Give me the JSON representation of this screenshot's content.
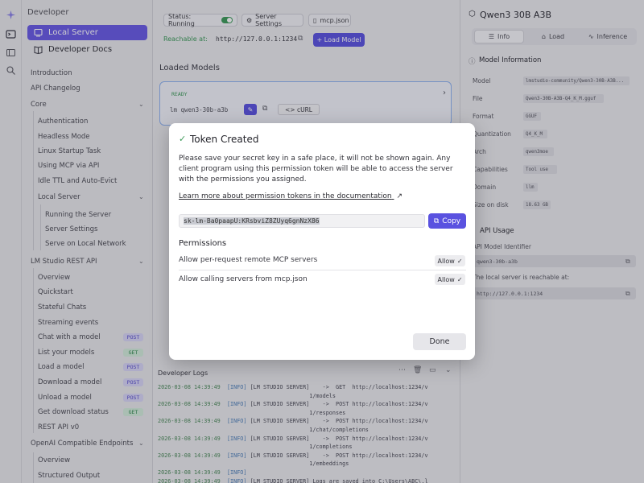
{
  "sidebar": {
    "section_title": "Developer",
    "local_server": "Local Server",
    "developer_docs": "Developer Docs",
    "items": {
      "introduction": "Introduction",
      "api_changelog": "API Changelog",
      "core": "Core",
      "authentication": "Authentication",
      "headless_mode": "Headless Mode",
      "linux_startup_task": "Linux Startup Task",
      "using_mcp": "Using MCP via API",
      "idle_ttl": "Idle TTL and Auto-Evict",
      "local_server": "Local Server",
      "running_server": "Running the Server",
      "server_settings": "Server Settings",
      "serve_network": "Serve on Local Network",
      "rest_api": "LM Studio REST API",
      "overview": "Overview",
      "quickstart": "Quickstart",
      "stateful_chats": "Stateful Chats",
      "streaming_events": "Streaming events",
      "chat_with_model": "Chat with a model",
      "list_models": "List your models",
      "load_model": "Load a model",
      "download_model": "Download a model",
      "unload_model": "Unload a model",
      "get_download_status": "Get download status",
      "rest_api_v0": "REST API v0",
      "openai_endpoints": "OpenAI Compatible Endpoints",
      "overview2": "Overview",
      "structured_output": "Structured Output"
    },
    "badges": {
      "post": "POST",
      "get": "GET"
    }
  },
  "main": {
    "status_label": "Status: Running",
    "server_settings": "Server Settings",
    "mcp_json": "mcp.json",
    "reachable_label": "Reachable at:",
    "reachable_url": "http://127.0.0.1:1234",
    "load_model": "+ Load Model",
    "loaded_models": "Loaded Models",
    "model_status": "READY",
    "model_id": "lm qwen3-30b-a3b",
    "curl_label": "<> cURL",
    "dev_logs": "Developer Logs"
  },
  "logs": [
    {
      "ts": "2026-03-08 14:39:49",
      "lvl": "[INFO]",
      "rest": " [LM STUDIO SERVER]    ->  GET  http://localhost:1234/v"
    },
    {
      "ts": "",
      "lvl": "",
      "rest": "                                              1/models"
    },
    {
      "ts": "2026-03-08 14:39:49",
      "lvl": "[INFO]",
      "rest": " [LM STUDIO SERVER]    ->  POST http://localhost:1234/v"
    },
    {
      "ts": "",
      "lvl": "",
      "rest": "                                              1/responses"
    },
    {
      "ts": "2026-03-08 14:39:49",
      "lvl": "[INFO]",
      "rest": " [LM STUDIO SERVER]    ->  POST http://localhost:1234/v"
    },
    {
      "ts": "",
      "lvl": "",
      "rest": "                                              1/chat/completions"
    },
    {
      "ts": "2026-03-08 14:39:49",
      "lvl": "[INFO]",
      "rest": " [LM STUDIO SERVER]    ->  POST http://localhost:1234/v"
    },
    {
      "ts": "",
      "lvl": "",
      "rest": "                                              1/completions"
    },
    {
      "ts": "2026-03-08 14:39:49",
      "lvl": "[INFO]",
      "rest": " [LM STUDIO SERVER]    ->  POST http://localhost:1234/v"
    },
    {
      "ts": "",
      "lvl": "",
      "rest": "                                              1/embeddings"
    },
    {
      "ts": "2026-03-08 14:39:49",
      "lvl": "[INFO]",
      "rest": ""
    },
    {
      "ts": "2026-03-08 14:39:49",
      "lvl": "[INFO]",
      "rest": " [LM STUDIO SERVER] Logs are saved into C:\\Users\\ABC\\.l"
    }
  ],
  "right": {
    "title": "Qwen3 30B A3B",
    "tabs": {
      "info": "Info",
      "load": "Load",
      "inference": "Inference"
    },
    "model_info_title": "Model Information",
    "rows": [
      {
        "label": "Model",
        "value": "lmstudio-community/Qwen3-30B-A3B..."
      },
      {
        "label": "File",
        "value": "Qwen3-30B-A3B-Q4_K_M.gguf"
      },
      {
        "label": "Format",
        "value": "GGUF"
      },
      {
        "label": "Quantization",
        "value": "Q4_K_M"
      },
      {
        "label": "Arch",
        "value": "qwen3moe"
      },
      {
        "label": "Capabilities",
        "value": "Tool use"
      },
      {
        "label": "Domain",
        "value": "llm"
      },
      {
        "label": "Size on disk",
        "value": "18.63 GB"
      }
    ],
    "api_usage_title": "API Usage",
    "api_identifier_label": "API Model Identifier",
    "api_identifier_value": "qwen3-30b-a3b",
    "reachable_note": "The local server is reachable at:",
    "reachable_value": "http://127.0.0.1:1234"
  },
  "modal": {
    "title": "Token Created",
    "message": "Please save your secret key in a safe place, it will not be shown again. Any client program using this permission token will be able to access the server with the permissions you assigned.",
    "learn_more": "Learn more about permission tokens in the documentation",
    "key": "sk-lm-Ba0paapU:KRsbviZ8ZUyq6gnNzX86",
    "copy": "Copy",
    "permissions_title": "Permissions",
    "perm1": "Allow per-request remote MCP servers",
    "perm2": "Allow calling servers from mcp.json",
    "allow": "Allow",
    "done": "Done"
  },
  "colors": {
    "accent": "#5c54e0",
    "success": "#3e9b5a",
    "post_badge": "#d9d7f6",
    "get_badge": "#d4eedc"
  }
}
